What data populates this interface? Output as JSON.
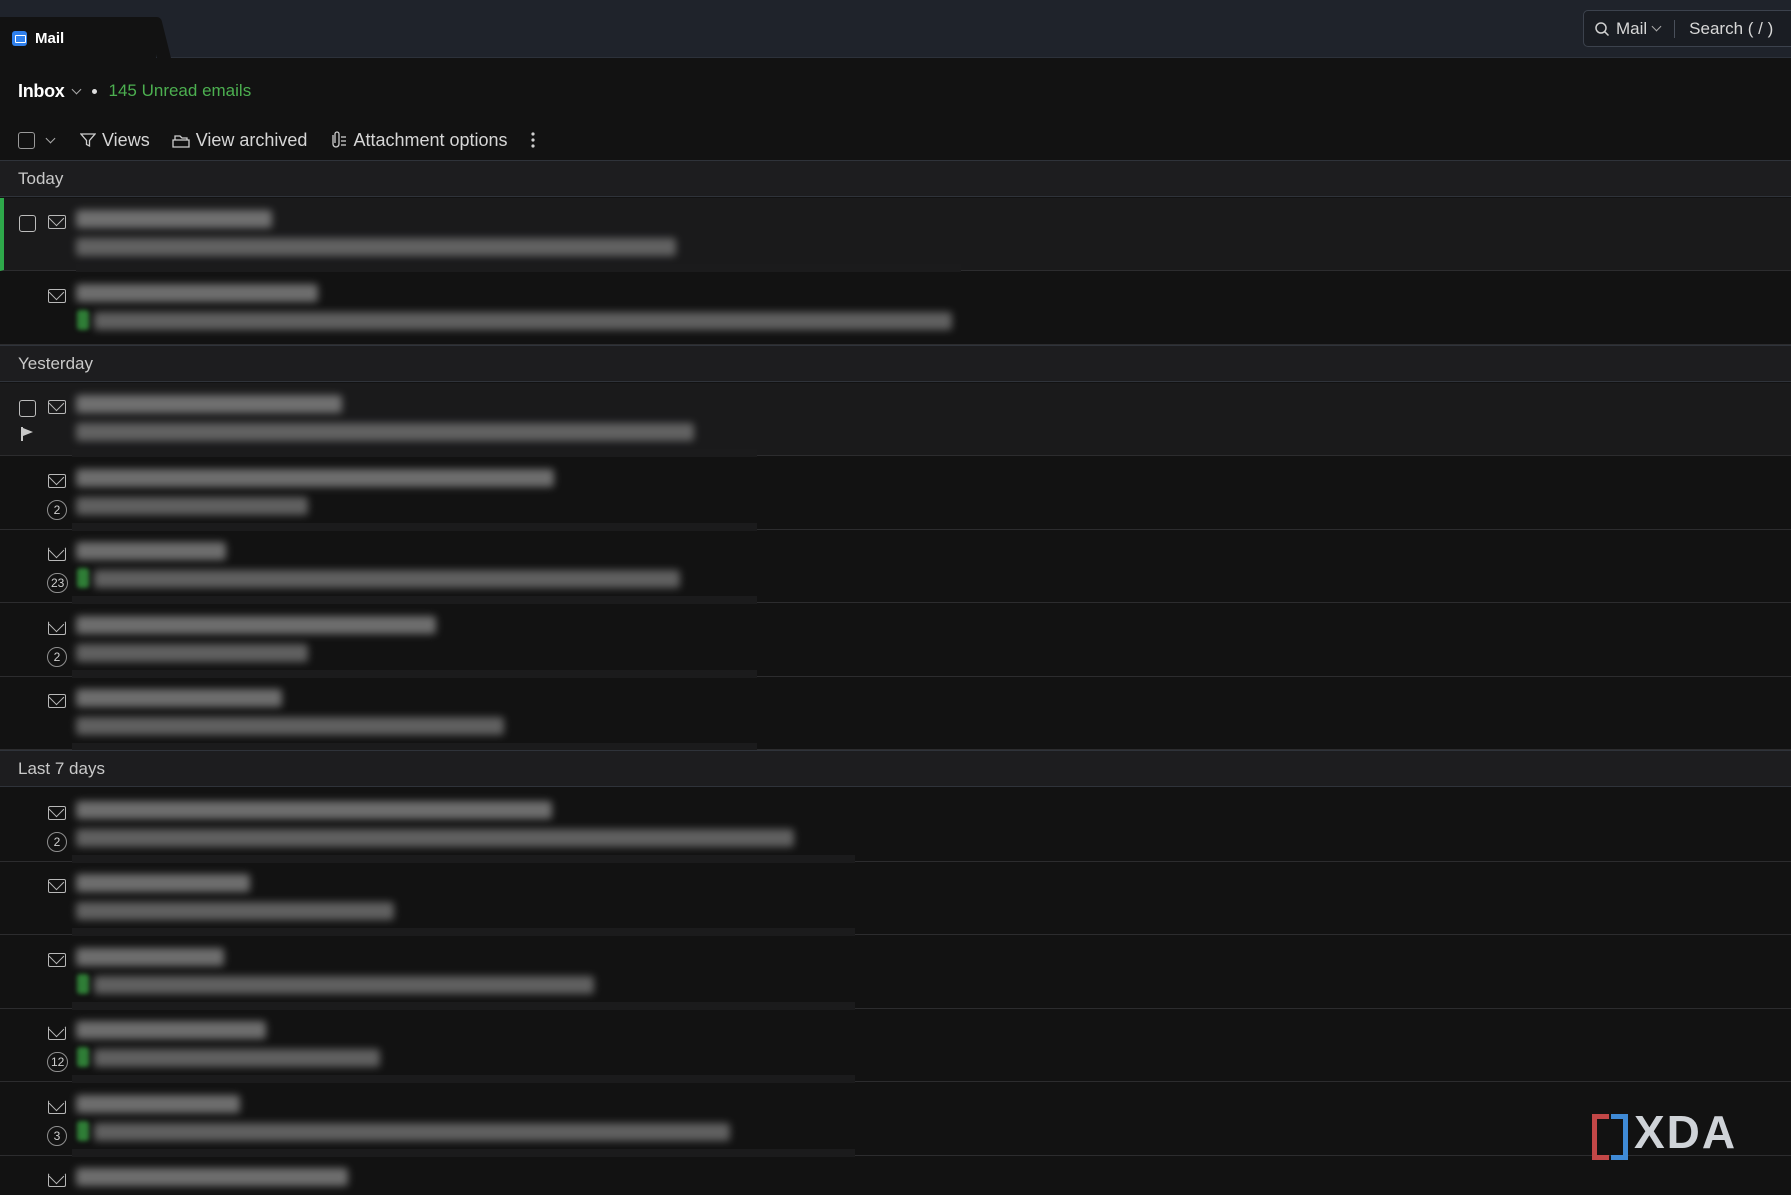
{
  "tab": {
    "label": "Mail"
  },
  "search": {
    "scope": "Mail",
    "placeholder": "Search ( / )"
  },
  "header": {
    "folder": "Inbox",
    "unread": "145 Unread emails"
  },
  "toolbar": {
    "views": "Views",
    "view_archived": "View archived",
    "attachment_options": "Attachment options"
  },
  "groups": {
    "today": "Today",
    "yesterday": "Yesterday",
    "last7": "Last 7 days"
  },
  "counts": {
    "r3": "2",
    "r4": "23",
    "r5": "2",
    "r7": "2",
    "r10": "12",
    "r11": "3"
  },
  "watermark": {
    "text": "XDA"
  }
}
